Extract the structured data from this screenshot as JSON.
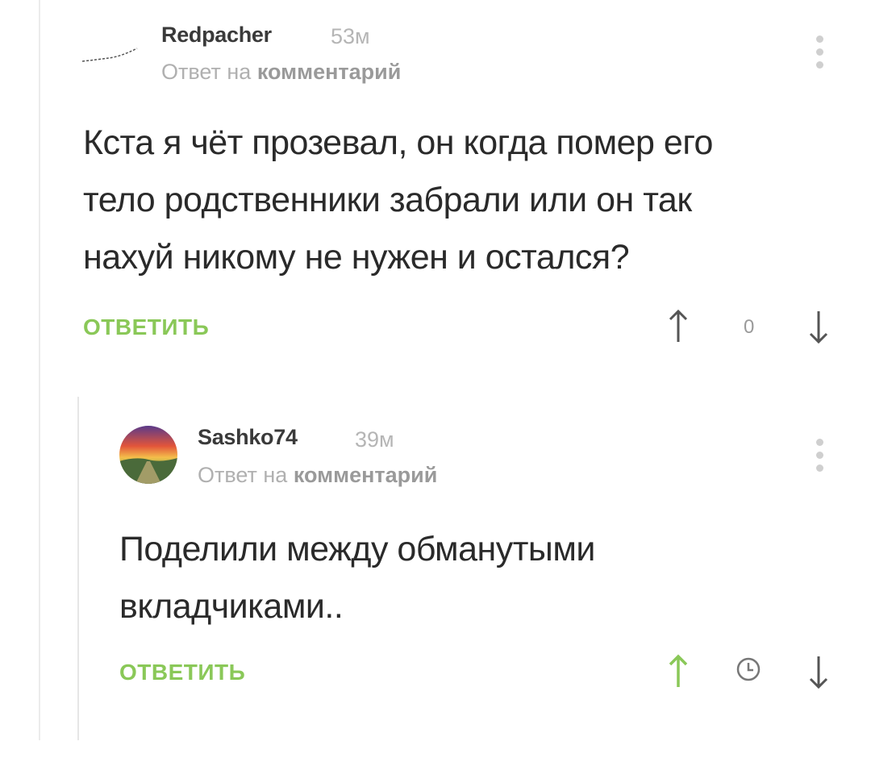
{
  "comments": [
    {
      "username": "Redpacher",
      "time": "53м",
      "reply_prefix": "Ответ на",
      "reply_target": "комментарий",
      "body_lines": [
        "Кста я чёт прозевал, он когда помер его",
        "тело родственники забрали или он так",
        "нахуй никому не нужен и остался?"
      ],
      "reply_label": "ОТВЕТИТЬ",
      "rating": "0",
      "menu_icon": "more-vertical-icon",
      "upvote_icon": "arrow-up-icon",
      "downvote_icon": "arrow-down-icon"
    },
    {
      "username": "Sashko74",
      "time": "39м",
      "reply_prefix": "Ответ на",
      "reply_target": "комментарий",
      "body_lines": [
        "Поделили между обманутыми",
        "вкладчиками.."
      ],
      "reply_label": "ОТВЕТИТЬ",
      "rating_icon": "clock-icon",
      "upvote_active": true,
      "menu_icon": "more-vertical-icon",
      "upvote_icon": "arrow-up-icon",
      "downvote_icon": "arrow-down-icon"
    }
  ],
  "colors": {
    "accent_green": "#8ac858",
    "muted_gray": "#b0b0b0",
    "text": "#2a2a2a"
  }
}
